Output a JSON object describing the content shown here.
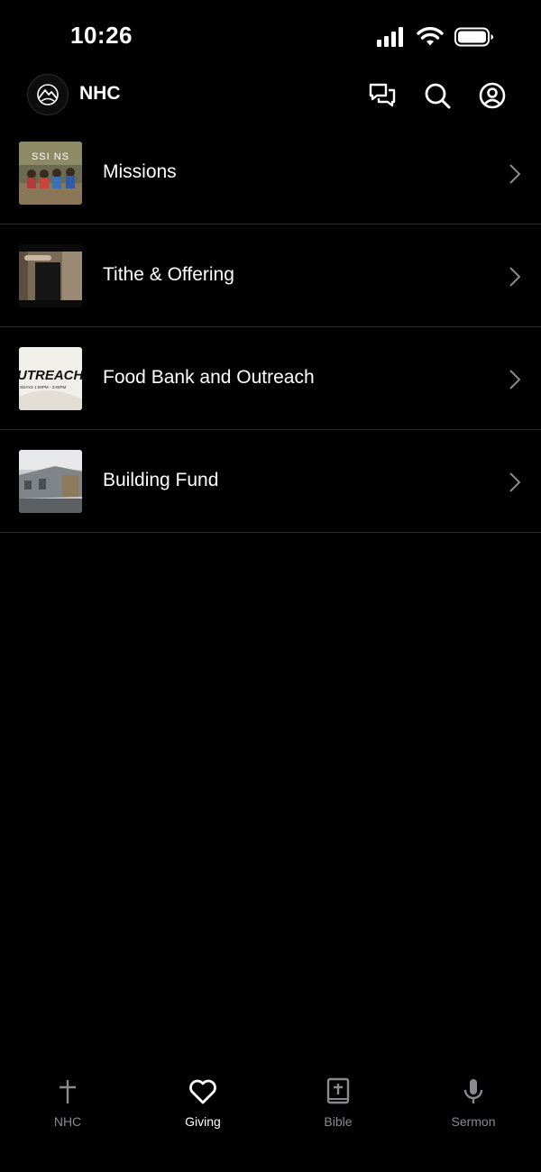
{
  "status_bar": {
    "time": "10:26"
  },
  "header": {
    "title": "NHC",
    "icons": [
      "logo-icon",
      "chat-icon",
      "search-icon",
      "profile-icon"
    ]
  },
  "list": {
    "items": [
      {
        "label": "Missions",
        "thumb_text": "SSI NS",
        "thumb_icon": "missions-thumbnail"
      },
      {
        "label": "Tithe & Offering",
        "thumb_icon": "tithe-thumbnail"
      },
      {
        "label": "Food Bank and Outreach",
        "thumb_text": "UTREACH",
        "thumb_subtext": "SDAYS 1:00PM - 3:00PM",
        "thumb_icon": "outreach-thumbnail"
      },
      {
        "label": "Building Fund",
        "thumb_icon": "building-thumbnail"
      }
    ]
  },
  "tab_bar": {
    "tabs": [
      {
        "label": "NHC",
        "icon": "cross-icon",
        "active": false
      },
      {
        "label": "Giving",
        "icon": "heart-icon",
        "active": true
      },
      {
        "label": "Bible",
        "icon": "bible-icon",
        "active": false
      },
      {
        "label": "Sermon",
        "icon": "microphone-icon",
        "active": false
      }
    ]
  },
  "colors": {
    "background": "#000000",
    "text": "#ffffff",
    "inactive_tab": "#8a8a8e",
    "divider": "#2c2c2e"
  }
}
